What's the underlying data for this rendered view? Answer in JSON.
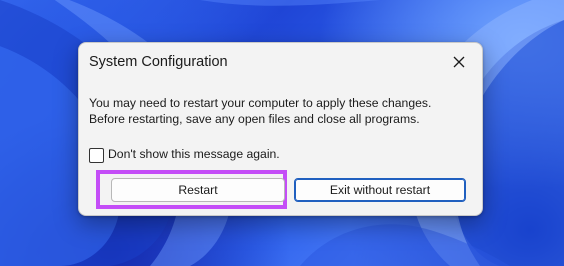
{
  "dialog": {
    "title": "System Configuration",
    "message_line1": "You may need to restart your computer to apply these changes.",
    "message_line2": "Before restarting, save any open files and close all programs.",
    "checkbox_label": "Don't show this message again.",
    "checkbox_checked": false,
    "restart_label": "Restart",
    "exit_label": "Exit without restart",
    "close_icon": "close-icon"
  },
  "colors": {
    "highlight": "#c44df7",
    "default_button_border": "#1f5fbf",
    "dialog_background": "#f3f3f3",
    "desktop_accent": "#2f63ee"
  }
}
